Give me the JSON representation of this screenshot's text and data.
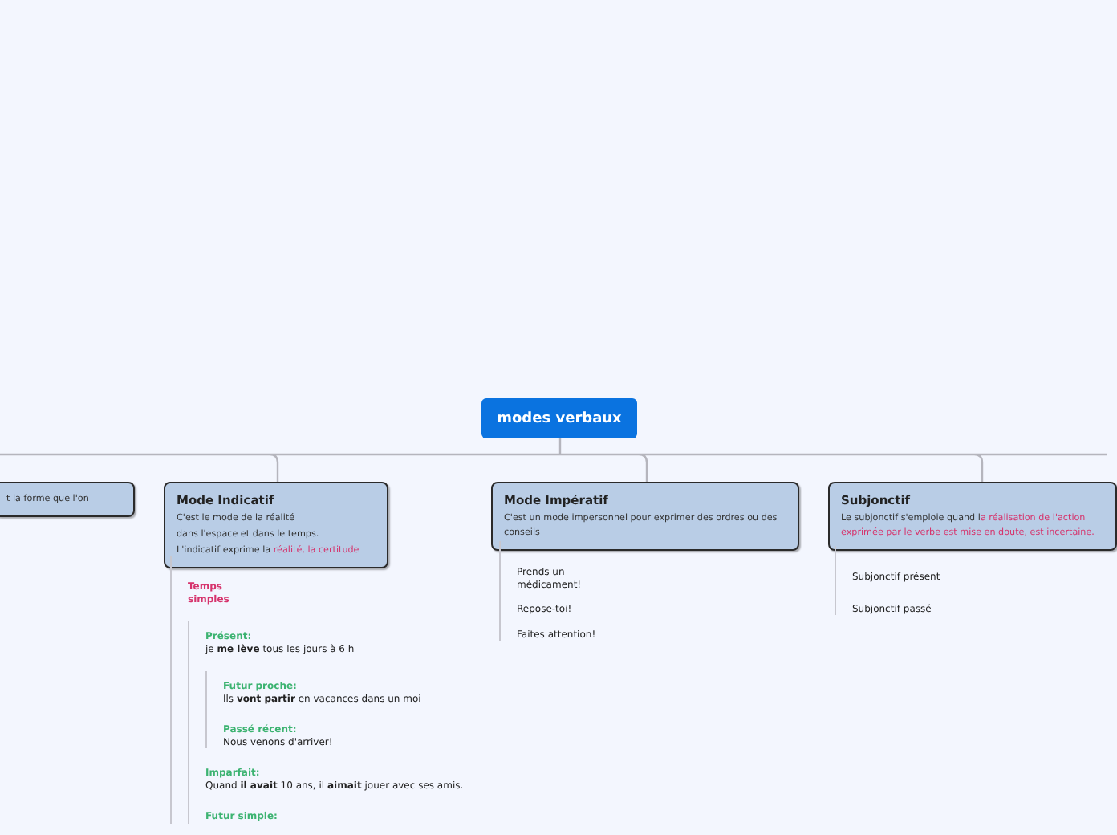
{
  "root": {
    "title": "modes verbaux"
  },
  "branches": [
    {
      "lines": [
        {
          "text": "t la forme que l'on"
        }
      ]
    },
    {
      "title": "Mode Indicatif",
      "lines": [
        {
          "text": "C'est le mode de la réalité"
        },
        {
          "text": "dans l'espace et dans le temps."
        },
        {
          "text": "L'indicatif exprime la ",
          "highlight": "réalité, la certitude"
        }
      ],
      "children": [
        {
          "label": "Temps simples",
          "color": "#d6336c",
          "children": [
            {
              "label": "Présent:",
              "color": "#3cb371",
              "text": "je **me lève** tous les jours à 6 h",
              "children": [
                {
                  "label": "Futur proche:",
                  "color": "#3cb371",
                  "text": "Ils **vont partir** en vacances dans un moi"
                },
                {
                  "label": "Passé récent:",
                  "color": "#3cb371",
                  "text": "Nous venons d'arriver!"
                }
              ]
            },
            {
              "label": "Imparfait:",
              "color": "#3cb371",
              "text": "Quand **il avait** 10 ans, il **aimait** jouer avec ses amis."
            },
            {
              "label": "Futur simple:",
              "color": "#3cb371"
            }
          ]
        }
      ]
    },
    {
      "title": "Mode Impératif",
      "lines": [
        {
          "text": "C'est un mode impersonnel pour exprimer des ordres ou des conseils"
        }
      ],
      "children": [
        {
          "text": "Prends un médicament!"
        },
        {
          "text": "Repose-toi!"
        },
        {
          "text": "Faites attention!"
        }
      ]
    },
    {
      "title": "Subjonctif",
      "lines": [
        {
          "text": "Le subjonctif s'emploie quand l",
          "highlight": "a réalisation de l'action exprimée par le verbe est mise en doute, est incertaine."
        }
      ],
      "children": [
        {
          "text": "Subjonctif présent"
        },
        {
          "text": "Subjonctif passé"
        }
      ]
    }
  ]
}
